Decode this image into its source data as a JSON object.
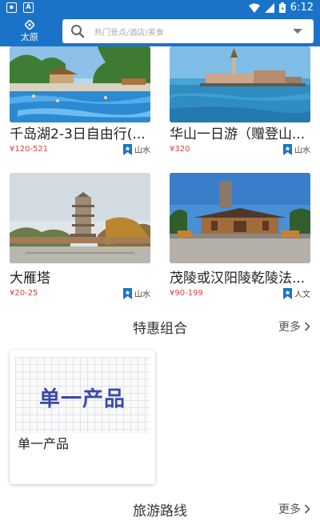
{
  "status": {
    "time": "6:12"
  },
  "header": {
    "city": "太原",
    "search_placeholder": "热门景点/酒店/美食"
  },
  "cards": [
    {
      "title": "千岛湖2-3日自由行(...",
      "price": "¥120-521",
      "tag": "山水"
    },
    {
      "title": "华山一日游（赠登山...",
      "price": "¥320",
      "tag": "山水"
    },
    {
      "title": "大雁塔",
      "price": "¥20-25",
      "tag": "山水"
    },
    {
      "title": "茂陵或汉阳陵乾陵法...",
      "price": "¥90-199",
      "tag": "人文"
    }
  ],
  "combos": {
    "title": "特惠组合",
    "more": "更多",
    "items": [
      {
        "image_text": "单一产品",
        "name": "单一产品"
      }
    ]
  },
  "routes": {
    "title": "旅游路线",
    "more": "更多"
  },
  "colors": {
    "primary": "#1a73c9",
    "price": "#d2463c",
    "tag_icon": "#1a73c9"
  }
}
